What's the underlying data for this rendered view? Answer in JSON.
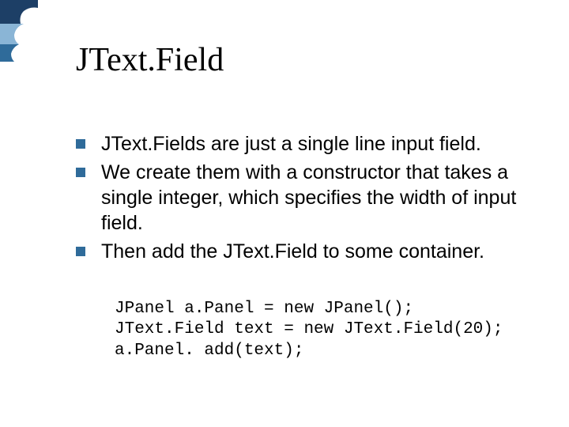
{
  "title": "JText.Field",
  "bullets": [
    "JText.Fields are just a single line input field.",
    "We create them with a constructor that takes a single integer, which specifies the width of input field.",
    "Then add the JText.Field to some container."
  ],
  "code_lines": [
    "JPanel a.Panel = new JPanel();",
    "JText.Field text = new JText.Field(20);",
    "a.Panel. add(text);"
  ],
  "colors": {
    "bullet": "#2f6b9a"
  }
}
